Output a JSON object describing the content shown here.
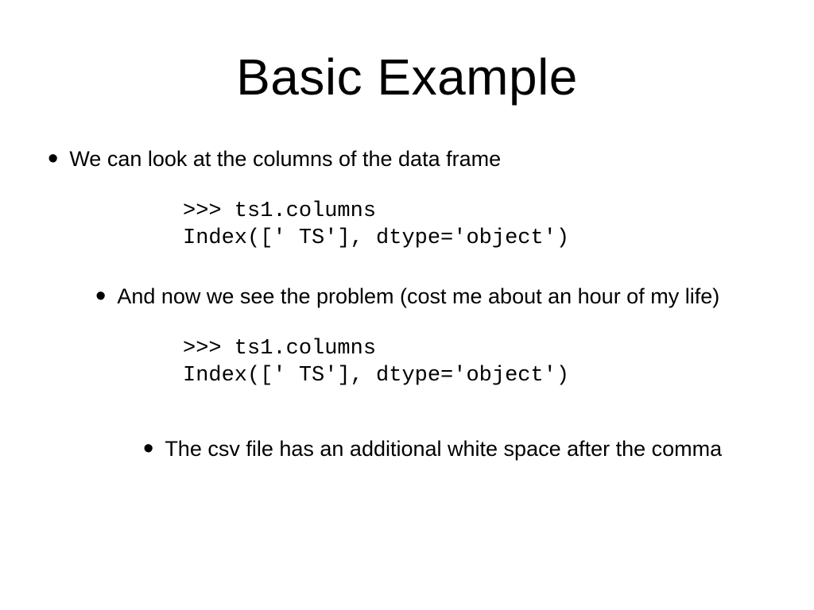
{
  "title": "Basic Example",
  "bullets": {
    "lvl1": "We can look at the columns of the data frame",
    "lvl2": "And now we see the problem (cost me about an hour of my life)",
    "lvl3": "The csv file has an additional white space after the comma"
  },
  "code": {
    "block1": ">>> ts1.columns\nIndex([' TS'], dtype='object')",
    "block2": ">>> ts1.columns\nIndex([' TS'], dtype='object')"
  }
}
